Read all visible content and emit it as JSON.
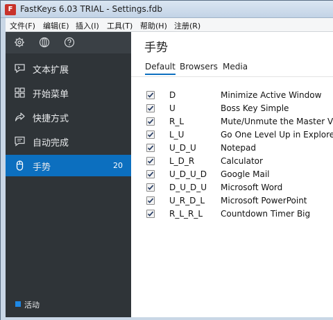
{
  "window": {
    "title": "FastKeys 6.03 TRIAL - Settings.fdb"
  },
  "menu": [
    "文件(F)",
    "编辑(E)",
    "插入(I)",
    "工具(T)",
    "帮助(H)",
    "注册(R)"
  ],
  "toolbar_icons": [
    "gear-icon",
    "globe-icon",
    "help-icon"
  ],
  "sidebar": {
    "items": [
      {
        "label": "文本扩展",
        "icon": "text-expand-icon"
      },
      {
        "label": "开始菜单",
        "icon": "start-menu-icon"
      },
      {
        "label": "快捷方式",
        "icon": "shortcut-icon"
      },
      {
        "label": "自动完成",
        "icon": "autocomplete-icon"
      },
      {
        "label": "手势",
        "icon": "mouse-icon",
        "count": "20",
        "active": true
      }
    ],
    "status_label": "活动"
  },
  "main": {
    "title": "手势",
    "tabs": [
      {
        "label": "Default",
        "active": true
      },
      {
        "label": "Browsers"
      },
      {
        "label": "Media"
      }
    ],
    "rows": [
      {
        "gesture": "D",
        "action": "Minimize Active Window"
      },
      {
        "gesture": "U",
        "action": "Boss Key Simple"
      },
      {
        "gesture": "R_L",
        "action": "Mute/Unmute the Master Volum"
      },
      {
        "gesture": "L_U",
        "action": "Go One Level Up in Explorer"
      },
      {
        "gesture": "U_D_U",
        "action": "Notepad"
      },
      {
        "gesture": "L_D_R",
        "action": "Calculator"
      },
      {
        "gesture": "U_D_U_D",
        "action": "Google Mail"
      },
      {
        "gesture": "D_U_D_U",
        "action": "Microsoft Word"
      },
      {
        "gesture": "U_R_D_L",
        "action": "Microsoft PowerPoint"
      },
      {
        "gesture": "R_L_R_L",
        "action": "Countdown Timer Big"
      }
    ]
  },
  "colors": {
    "sidebar_bg": "#2f3438",
    "accent": "#0c6fbf"
  }
}
